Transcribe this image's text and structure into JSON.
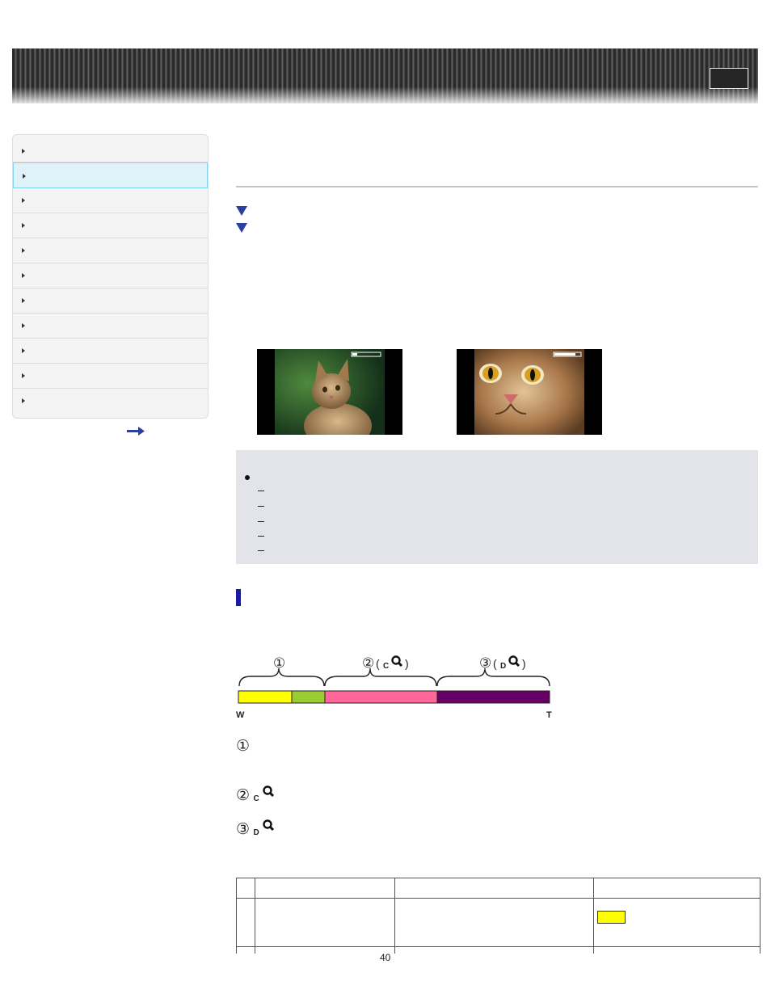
{
  "header": {
    "button_icon": "top-button"
  },
  "sidebar": {
    "items": [
      {
        "label": "",
        "active": false
      },
      {
        "label": "",
        "active": true
      },
      {
        "label": "",
        "active": false
      },
      {
        "label": "",
        "active": false
      },
      {
        "label": "",
        "active": false
      },
      {
        "label": "",
        "active": false
      },
      {
        "label": "",
        "active": false
      },
      {
        "label": "",
        "active": false
      },
      {
        "label": "",
        "active": false
      },
      {
        "label": "",
        "active": false
      },
      {
        "label": "",
        "active": false
      }
    ],
    "arrow_icon": "arrow-right-icon"
  },
  "zoom_scale": {
    "wide_label": "W",
    "tele_label": "T",
    "segment_1": {
      "number": "①"
    },
    "segment_2": {
      "number": "②",
      "prefix": "C"
    },
    "segment_3": {
      "number": "③",
      "prefix": "D"
    },
    "colors": {
      "yellow": "#ffff00",
      "green": "#99cc33",
      "pink": "#ff6699",
      "purple": "#660066"
    }
  },
  "legend": [
    {
      "number": "①",
      "prefix": ""
    },
    {
      "number": "②",
      "prefix": "C"
    },
    {
      "number": "③",
      "prefix": "D"
    }
  ],
  "table": {
    "highlight_color": "#ffff00"
  },
  "footer": {
    "page_number": "40"
  },
  "colors": {
    "accent": "#1a1aa8",
    "jump_arrow": "#2b3fa0",
    "note_bg": "#e2e4ea"
  }
}
